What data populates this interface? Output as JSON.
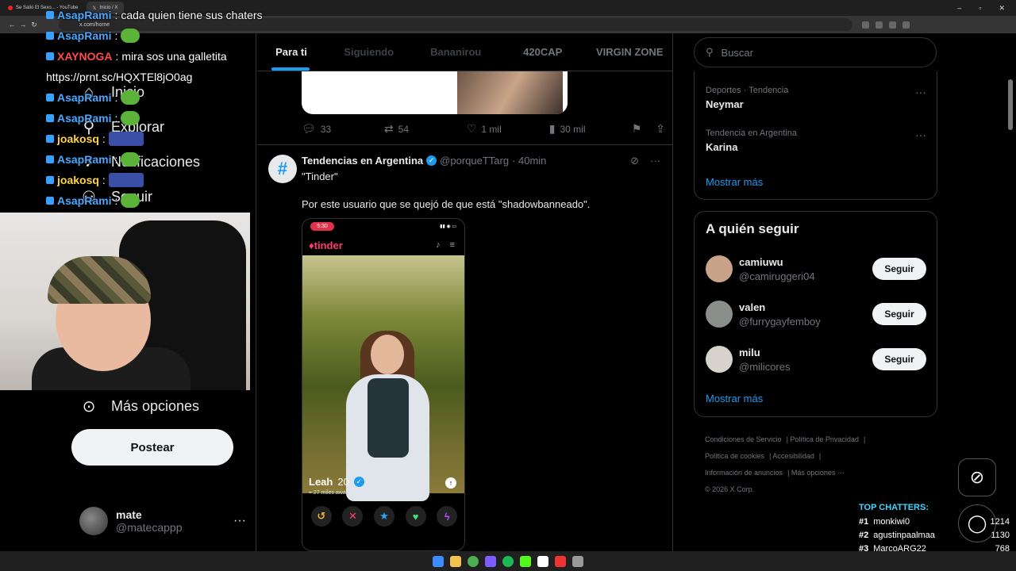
{
  "browser": {
    "tabs": [
      {
        "label": "Se Salió El Sexo... - YouTube"
      },
      {
        "label": "Inicio / X"
      }
    ],
    "url": "x.com/home"
  },
  "sidebar": {
    "nav": [
      {
        "label": "Inicio",
        "icon": "home-icon"
      },
      {
        "label": "Explorar",
        "icon": "search-icon"
      },
      {
        "label": "Notificaciones",
        "icon": "bell-icon"
      },
      {
        "label": "Seguir",
        "icon": "add-user-icon"
      },
      {
        "label": "Más opciones",
        "icon": "more-circle-icon"
      }
    ],
    "post_label": "Postear",
    "profile": {
      "name": "mate",
      "handle": "@matecappp",
      "more": "···"
    }
  },
  "chat": [
    {
      "user": "AsapRami",
      "text": "cada quien tiene sus chaters",
      "color": "#4aa8ff",
      "emote": ""
    },
    {
      "user": "AsapRami",
      "text": "",
      "color": "#4aa8ff",
      "emote": "frog"
    },
    {
      "user": "XAYNOGA",
      "text": "mira sos una galletita",
      "color": "#ff4b4b",
      "emote": ""
    },
    {
      "user": "",
      "text": "https://prnt.sc/HQXTEl8jO0ag",
      "color": "#ffffff",
      "emote": ""
    },
    {
      "user": "AsapRami",
      "text": "",
      "color": "#4aa8ff",
      "emote": "frog"
    },
    {
      "user": "AsapRami",
      "text": "",
      "color": "#4aa8ff",
      "emote": "frog"
    },
    {
      "user": "joakosq",
      "text": "",
      "color": "#ffd43b",
      "emote": "blue"
    },
    {
      "user": "AsapRami",
      "text": "",
      "color": "#4aa8ff",
      "emote": "frog"
    },
    {
      "user": "joakosq",
      "text": "",
      "color": "#ffd43b",
      "emote": "blue"
    },
    {
      "user": "AsapRami",
      "text": "",
      "color": "#4aa8ff",
      "emote": "frog"
    }
  ],
  "feed": {
    "tabs": [
      "Para ti",
      "Siguiendo",
      "Bananirou",
      "420CAP",
      "VIRGIN ZONE"
    ],
    "prev_actions": {
      "replies": "33",
      "reposts": "54",
      "likes": "1 mil",
      "views": "30 mil"
    },
    "tweet": {
      "name": "Tendencias en Argentina",
      "handle": "@porqueTTarg",
      "time": "· 40min",
      "line1": "\"Tinder\"",
      "line2": "Por este usuario que se quejó de que está \"shadowbanneado\".",
      "phone": {
        "time": "5:30",
        "logo": "tinder",
        "name": "Leah",
        "age": "20",
        "distance": "27 miles away"
      }
    }
  },
  "right": {
    "search_placeholder": "Buscar",
    "trends": [
      {
        "context": "Deportes · Tendencia",
        "title": "Neymar"
      },
      {
        "context": "Tendencia en Argentina",
        "title": "Karina"
      }
    ],
    "trends_more": "Mostrar más",
    "follow_title": "A quién seguir",
    "follow": [
      {
        "name": "camiuwu",
        "handle": "@camiruggeri04",
        "button": "Seguir",
        "color": "#c9a389"
      },
      {
        "name": "valen",
        "handle": "@furrygayfemboy",
        "button": "Seguir",
        "color": "#8a8f8c"
      },
      {
        "name": "milu",
        "handle": "@milicores",
        "button": "Seguir",
        "color": "#d8d2cc"
      }
    ],
    "follow_more": "Mostrar más",
    "footer": [
      "Condiciones de Servicio",
      "Política de Privacidad",
      "Política de cookies",
      "Accesibilidad",
      "Información de anuncios",
      "Más opciones ···",
      "© 2026 X Corp."
    ]
  },
  "top_chatters": {
    "title": "TOP CHATTERS:",
    "rows": [
      {
        "rank": "#1",
        "name": "monkiwi0",
        "count": "1214"
      },
      {
        "rank": "#2",
        "name": "agustinpaalmaa",
        "count": "1130"
      },
      {
        "rank": "#3",
        "name": "MarcoARG22",
        "count": "768"
      }
    ]
  },
  "colors": {
    "accent": "#1d9bf0",
    "tinder": "#fe3c72"
  }
}
